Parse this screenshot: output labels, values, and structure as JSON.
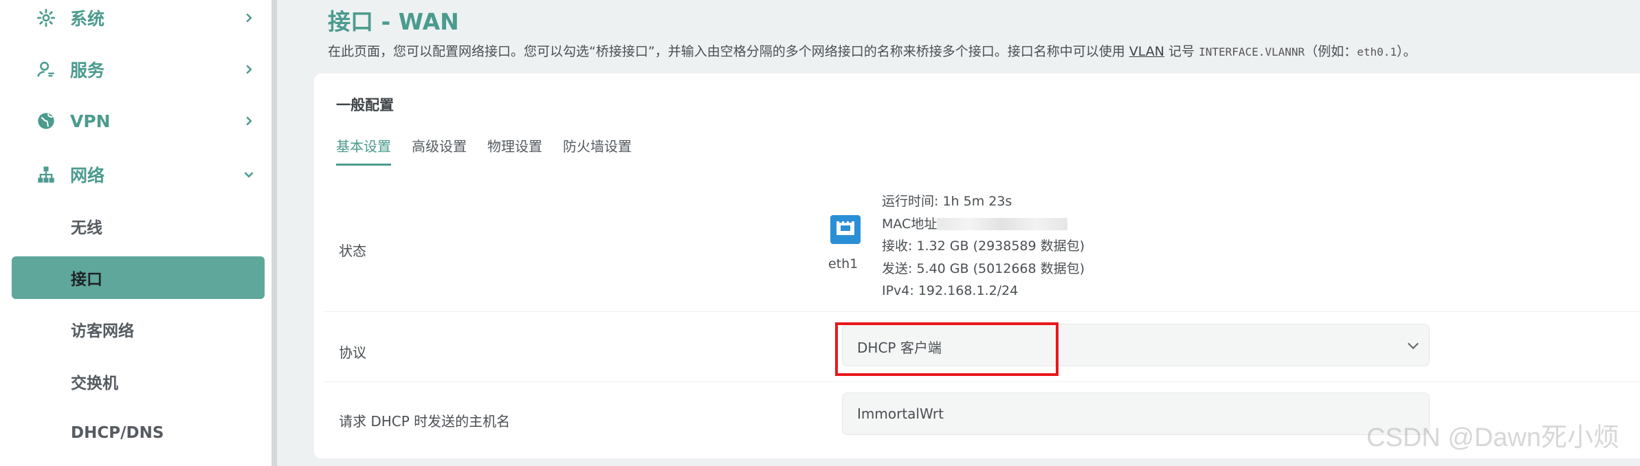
{
  "sidebar": {
    "top_items": [
      {
        "label": "系统",
        "icon": "gear-icon"
      },
      {
        "label": "服务",
        "icon": "user-icon"
      },
      {
        "label": "VPN",
        "icon": "globe-icon"
      },
      {
        "label": "网络",
        "icon": "network-icon"
      }
    ],
    "network_sub": [
      "无线",
      "接口",
      "访客网络",
      "交换机",
      "DHCP/DNS"
    ],
    "active_sub": "接口"
  },
  "header": {
    "title": "接口 - WAN",
    "desc_before": "在此页面，您可以配置网络接口。您可以勾选“桥接接口”，并输入由空格分隔的多个网络接口的名称来桥接多个接口。接口名称中可以使用 ",
    "desc_link": "VLAN",
    "desc_mid": " 记号 ",
    "desc_mono": "INTERFACE.VLANNR",
    "desc_after": "（例如：",
    "desc_mono2": "eth0.1",
    "desc_end": "）。"
  },
  "section": {
    "title": "一般配置",
    "tabs": [
      "基本设置",
      "高级设置",
      "物理设置",
      "防火墙设置"
    ]
  },
  "status": {
    "label": "状态",
    "device": "eth1",
    "uptime": "运行时间: 1h 5m 23s",
    "mac_label": "MAC地址",
    "rx": "接收: 1.32 GB (2938589 数据包)",
    "tx": "发送: 5.40 GB (5012668 数据包)",
    "ipv4": "IPv4: 192.168.1.2/24"
  },
  "protocol": {
    "label": "协议",
    "value": "DHCP 客户端"
  },
  "hostname": {
    "label": "请求 DHCP 时发送的主机名",
    "value": "ImmortalWrt"
  },
  "watermark": "CSDN @Dawn死小烦",
  "colors": {
    "accent": "#4b9b8e",
    "active_bg": "#5ea79a",
    "highlight": "#e8171b"
  }
}
